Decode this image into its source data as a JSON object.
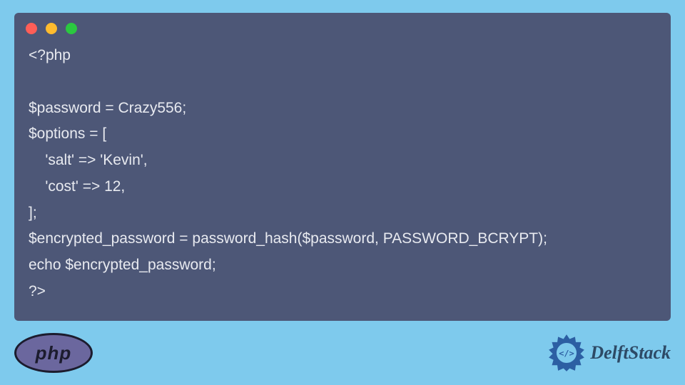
{
  "window": {
    "dots": [
      "red",
      "yellow",
      "green"
    ]
  },
  "code": {
    "line1": "<?php",
    "line2": "",
    "line3": "$password = Crazy556;",
    "line4": "$options = [",
    "line5": "    'salt' => 'Kevin',",
    "line6": "    'cost' => 12,",
    "line7": "];",
    "line8": "$encrypted_password = password_hash($password, PASSWORD_BCRYPT);",
    "line9": "echo $encrypted_password;",
    "line10": "?>"
  },
  "footer": {
    "php_label": "php",
    "brand": "DelftStack"
  },
  "colors": {
    "page_bg": "#7ecaed",
    "window_bg": "#4d5777",
    "code_text": "#e8eaf0",
    "php_badge_bg": "#6b679e",
    "php_badge_border": "#1c1c2e",
    "brand_text": "#2d4a66",
    "brand_icon": "#2c5fa3"
  }
}
